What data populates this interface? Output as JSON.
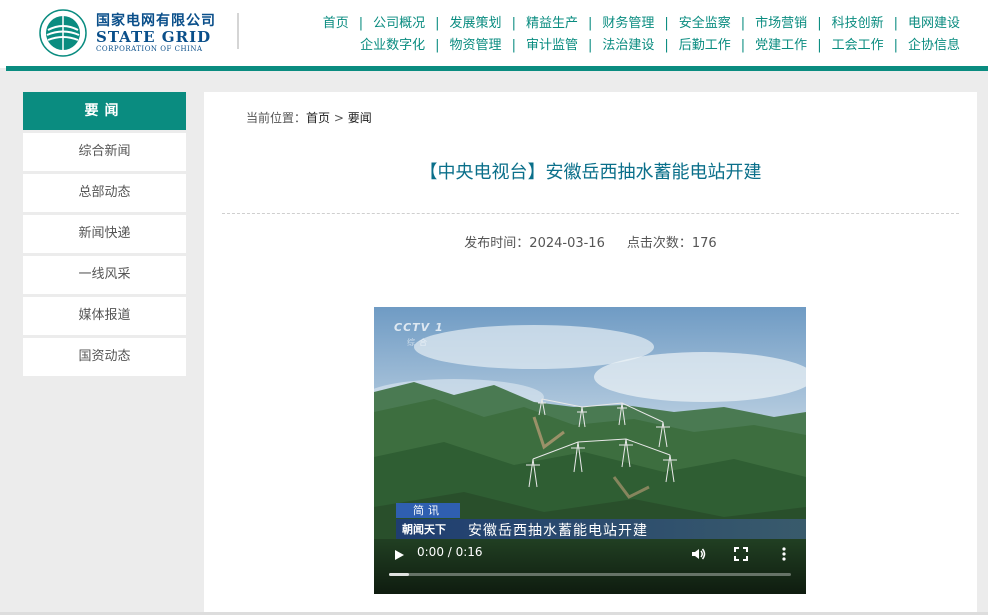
{
  "header": {
    "logo_cn": "国家电网有限公司",
    "logo_en": "STATE GRID",
    "logo_sub": "CORPORATION OF CHINA",
    "nav_row1": [
      "首页",
      "公司概况",
      "发展策划",
      "精益生产",
      "财务管理",
      "安全监察",
      "市场营销",
      "科技创新",
      "电网建设"
    ],
    "nav_row2": [
      "企业数字化",
      "物资管理",
      "审计监管",
      "法治建设",
      "后勤工作",
      "党建工作",
      "工会工作",
      "企协信息"
    ]
  },
  "sidebar": {
    "heading": "要闻",
    "items": [
      "综合新闻",
      "总部动态",
      "新闻快递",
      "一线风采",
      "媒体报道",
      "国资动态"
    ]
  },
  "content": {
    "breadcrumb_prefix": "当前位置：",
    "breadcrumb_home": "首页",
    "breadcrumb_sep": " > ",
    "breadcrumb_current": "要闻",
    "title": "【中央电视台】安徽岳西抽水蓄能电站开建",
    "publish_label": "发布时间：",
    "publish_date": "2024-03-16",
    "views_label": "点击次数：",
    "views": "176"
  },
  "video": {
    "channel_logo": "CCTV 1",
    "channel_sub": "综合",
    "ticker_tag": "简讯",
    "ticker_brand": "朝闻天下",
    "ticker_text": "安徽岳西抽水蓄能电站开建",
    "time": "0:00 / 0:16",
    "progress": 0.05
  },
  "colors": {
    "brand": "#0a8c80",
    "title": "#0a6f8a",
    "logo": "#0a4f8a"
  }
}
